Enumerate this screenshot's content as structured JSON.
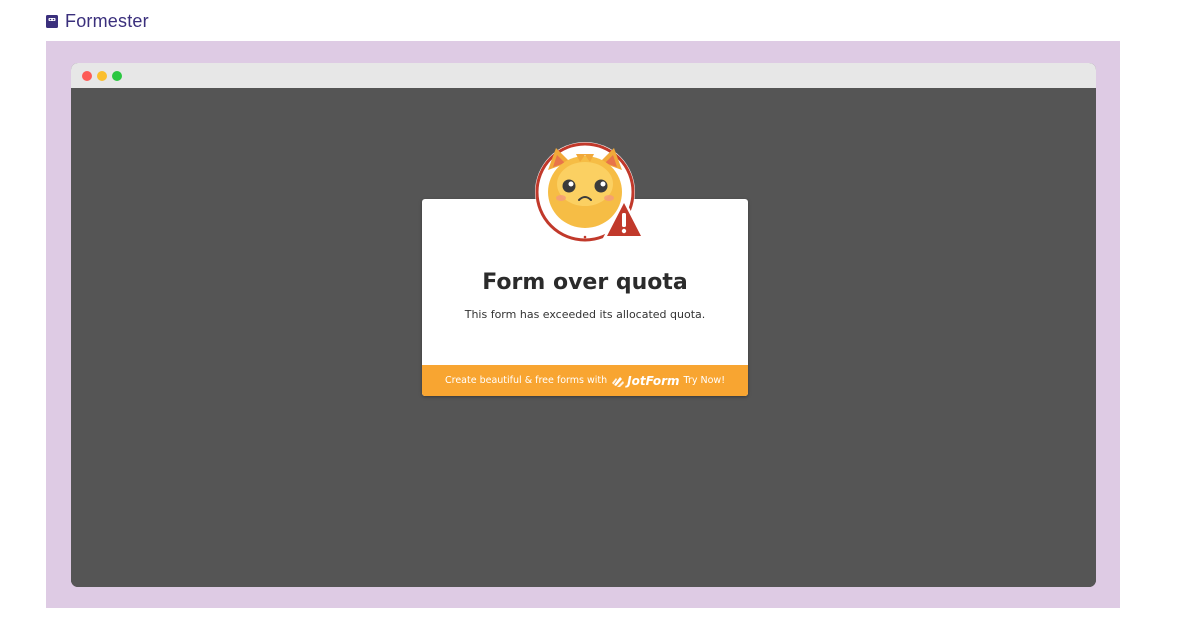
{
  "brand": {
    "name": "Formester",
    "icon": "formester-logo-icon"
  },
  "window": {
    "controls": [
      "close",
      "minimize",
      "maximize"
    ]
  },
  "card": {
    "title": "Form over quota",
    "message": "This form has exceeded its allocated quota.",
    "footer": {
      "text": "Create beautiful & free forms with",
      "logo_text": "JotForm",
      "cta": "Try Now!"
    }
  },
  "mascot": {
    "icon": "sad-cat-warning-icon"
  },
  "colors": {
    "frame_bg": "#decbe4",
    "viewport_bg": "#555555",
    "footer_bg": "#f8a531",
    "brand_text": "#3a2f7c",
    "warning_red": "#c1392b"
  }
}
